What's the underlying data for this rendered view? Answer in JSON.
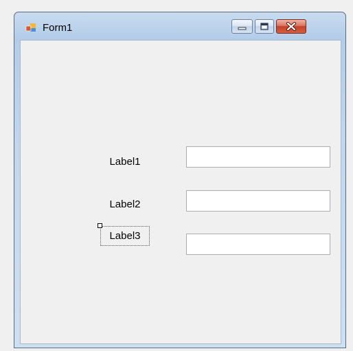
{
  "window": {
    "title": "Form1"
  },
  "form": {
    "labels": [
      "Label1",
      "Label2",
      "Label3"
    ],
    "textboxes": [
      {
        "value": "",
        "placeholder": ""
      },
      {
        "value": "",
        "placeholder": ""
      },
      {
        "value": "",
        "placeholder": ""
      }
    ]
  },
  "colors": {
    "close_button": "#c2412a",
    "titlebar": "#b3cce8",
    "client_bg": "#f0f0f0"
  }
}
